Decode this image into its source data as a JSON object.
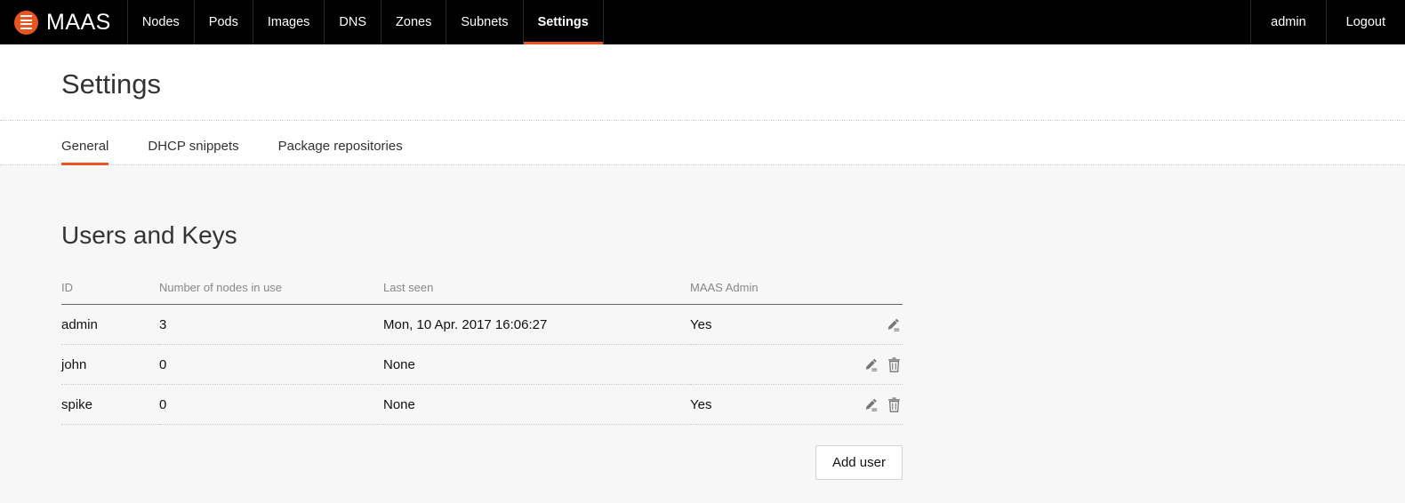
{
  "nav": {
    "brand": {
      "name": "MAAS",
      "logo_icon": "maas-circle-lines-icon"
    },
    "items": [
      {
        "label": "Nodes",
        "active": false
      },
      {
        "label": "Pods",
        "active": false
      },
      {
        "label": "Images",
        "active": false
      },
      {
        "label": "DNS",
        "active": false
      },
      {
        "label": "Zones",
        "active": false
      },
      {
        "label": "Subnets",
        "active": false
      },
      {
        "label": "Settings",
        "active": true
      }
    ],
    "user_label": "admin",
    "logout_label": "Logout"
  },
  "header": {
    "title": "Settings"
  },
  "tabs": [
    {
      "label": "General",
      "active": true
    },
    {
      "label": "DHCP snippets",
      "active": false
    },
    {
      "label": "Package repositories",
      "active": false
    }
  ],
  "main": {
    "section_title": "Users and Keys",
    "table": {
      "columns": [
        "ID",
        "Number of nodes in use",
        "Last seen",
        "MAAS Admin",
        ""
      ],
      "rows": [
        {
          "id": "admin",
          "nodes": "3",
          "last_seen": "Mon, 10 Apr. 2017 16:06:27",
          "maas_admin": "Yes",
          "edit_icon": "pencil-icon",
          "delete_icon": null
        },
        {
          "id": "john",
          "nodes": "0",
          "last_seen": "None",
          "maas_admin": "",
          "edit_icon": "pencil-icon",
          "delete_icon": "trash-icon"
        },
        {
          "id": "spike",
          "nodes": "0",
          "last_seen": "None",
          "maas_admin": "Yes",
          "edit_icon": "pencil-icon",
          "delete_icon": "trash-icon"
        }
      ]
    },
    "add_user_label": "Add user"
  },
  "colors": {
    "accent": "#e95420",
    "nav_background": "#000000",
    "page_background": "#f7f7f7",
    "panel_background": "#ffffff",
    "text": "#111111",
    "muted_text": "#888888"
  }
}
